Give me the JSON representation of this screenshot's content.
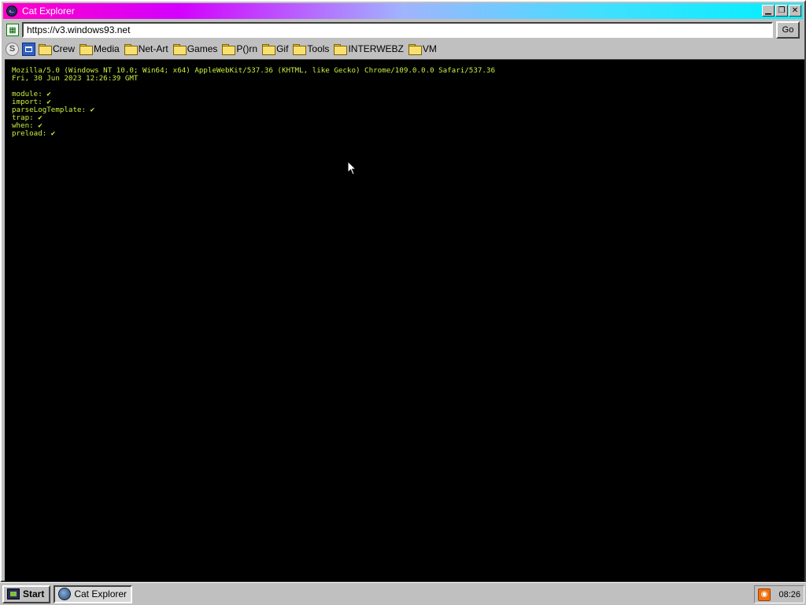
{
  "window": {
    "title": "Cat Explorer",
    "controls": {
      "minimize_icon": "minimize-icon",
      "restore_icon": "restore-icon",
      "close_icon": "close-icon"
    }
  },
  "address": {
    "url": "https://v3.windows93.net",
    "go_label": "Go"
  },
  "bookmarks": [
    {
      "label": "Crew"
    },
    {
      "label": "Media"
    },
    {
      "label": "Net-Art"
    },
    {
      "label": "Games"
    },
    {
      "label": "P()rn"
    },
    {
      "label": "Gif"
    },
    {
      "label": "Tools"
    },
    {
      "label": "INTERWEBZ"
    },
    {
      "label": "VM"
    }
  ],
  "console": {
    "user_agent": "Mozilla/5.0 (Windows NT 10.0; Win64; x64) AppleWebKit/537.36 (KHTML, like Gecko) Chrome/109.0.0.0 Safari/537.36",
    "date": "Fri, 30 Jun 2023 12:26:39 GMT",
    "checks": [
      "module: ✔",
      "import: ✔",
      "parseLogTemplate: ✔",
      "trap: ✔",
      "when: ✔",
      "preload: ✔"
    ]
  },
  "taskbar": {
    "start_label": "Start",
    "task_label": "Cat Explorer",
    "clock": "08:26"
  },
  "colors": {
    "console_text": "#c8f040",
    "console_bg": "#000000",
    "titlebar_start": "#ff00c8",
    "titlebar_end": "#00f0ff"
  }
}
